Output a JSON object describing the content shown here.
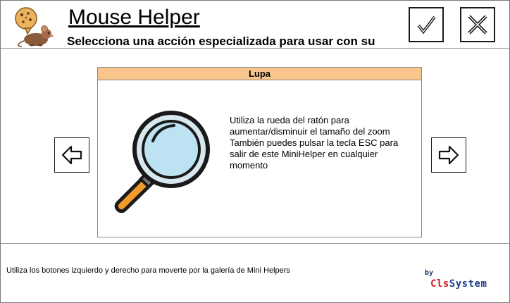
{
  "header": {
    "title": "Mouse Helper",
    "subtitle": "Selecciona una acción especializada para usar con su",
    "logo_icon": "mouse-with-cookie-icon",
    "ok_icon": "checkmark-icon",
    "close_icon": "close-x-icon"
  },
  "gallery": {
    "prev_icon": "arrow-left-icon",
    "next_icon": "arrow-right-icon",
    "card": {
      "title": "Lupa",
      "icon": "magnifying-glass-icon",
      "description_lines": [
        "Utiliza la rueda del ratón para",
        "aumentar/disminuir el tamaño del zoom",
        "También puedes pulsar la tecla ESC para",
        "salir de este MiniHelper en cualquier",
        "momento"
      ]
    }
  },
  "footer": {
    "hint": "Utiliza los botones izquierdo y derecho para moverte por la galería de Mini Helpers",
    "brand_by": "by",
    "brand_cls": "Cls",
    "brand_system": "System"
  },
  "colors": {
    "card_header": "#f8c58c",
    "brand_red": "#d02020",
    "brand_blue": "#1f3f8f",
    "lens_blue": "#bde3f2",
    "handle_orange": "#f39a2c"
  }
}
